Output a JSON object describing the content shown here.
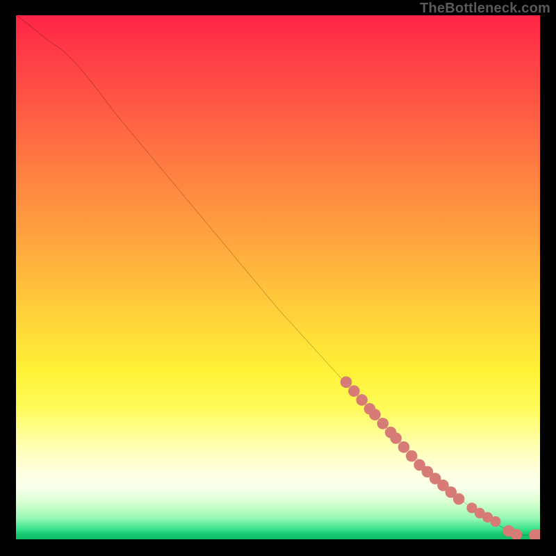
{
  "watermark": "TheBottleneck.com",
  "chart_data": {
    "type": "line",
    "title": "",
    "xlabel": "",
    "ylabel": "",
    "xlim": [
      0,
      100
    ],
    "ylim": [
      0,
      100
    ],
    "grid": false,
    "legend": false,
    "line": {
      "x": [
        0,
        4,
        8,
        12,
        20,
        30,
        40,
        50,
        60,
        70,
        80,
        88,
        93,
        96,
        100
      ],
      "y": [
        100,
        97,
        94,
        90,
        80,
        68,
        56,
        44,
        33,
        22,
        12,
        5,
        2,
        0.8,
        0.8
      ]
    },
    "series": [
      {
        "name": "markers-cluster-upper",
        "type": "scatter",
        "color": "#d77b76",
        "x": [
          63,
          64.5,
          66,
          67.5,
          68.5,
          70,
          71.5,
          72.5,
          74,
          75.5,
          77,
          78.5,
          80,
          81.5,
          83,
          84.5
        ],
        "y": [
          30.0,
          28.3,
          26.6,
          24.9,
          23.8,
          22.1,
          20.4,
          19.3,
          17.6,
          15.9,
          14.2,
          12.9,
          11.6,
          10.3,
          9.0,
          7.7
        ]
      },
      {
        "name": "markers-cluster-mid",
        "type": "scatter",
        "color": "#d77b76",
        "x": [
          87,
          88.5,
          90,
          91.5
        ],
        "y": [
          6.0,
          5.0,
          4.2,
          3.4
        ]
      },
      {
        "name": "markers-cluster-lower",
        "type": "scatter",
        "color": "#d77b76",
        "x": [
          94,
          95.5,
          99,
          100
        ],
        "y": [
          1.6,
          0.9,
          0.8,
          0.8
        ]
      }
    ]
  }
}
